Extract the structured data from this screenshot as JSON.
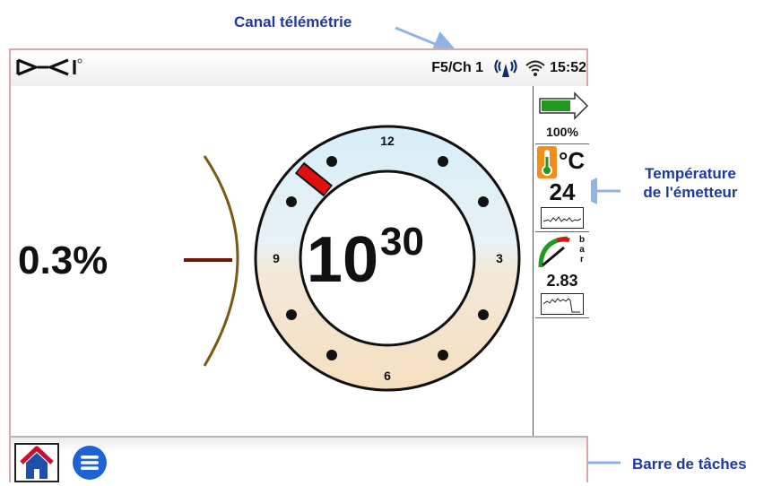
{
  "callouts": {
    "telemetry": "Canal télémétrie",
    "temperature_line1": "Température",
    "temperature_line2": "de l'émetteur",
    "taskbar": "Barre de tâches"
  },
  "status_bar": {
    "logo": "D-CI",
    "channel": "F5/Ch 1",
    "antenna_icon": "antenna-icon",
    "wifi_icon": "wifi-icon",
    "time": "15:52"
  },
  "pitch": {
    "value": "0.3%"
  },
  "roll_clock": {
    "hour": "10",
    "minute": "30",
    "tick_12": "12",
    "tick_3": "3",
    "tick_6": "6",
    "tick_9": "9"
  },
  "sidebar": {
    "battery": {
      "icon": "battery-icon",
      "level": "100%"
    },
    "temperature": {
      "icon": "thermometer-icon",
      "unit": "°C",
      "value": "24",
      "graph_icon": "graph-icon"
    },
    "pressure": {
      "icon": "pressure-gauge-icon",
      "unit_chars": [
        "b",
        "a",
        "r"
      ],
      "value": "2.83",
      "graph_icon": "graph-icon"
    }
  },
  "taskbar": {
    "home_icon": "home-icon",
    "menu_icon": "menu-icon"
  },
  "colors": {
    "callout": "#1f3a9e",
    "arrow": "#8fb4e3",
    "ring_top": "#d6eef8",
    "ring_bottom": "#f5dfc0",
    "roll_indicator": "#e01010",
    "pitch_arc": "#7a5a12"
  }
}
